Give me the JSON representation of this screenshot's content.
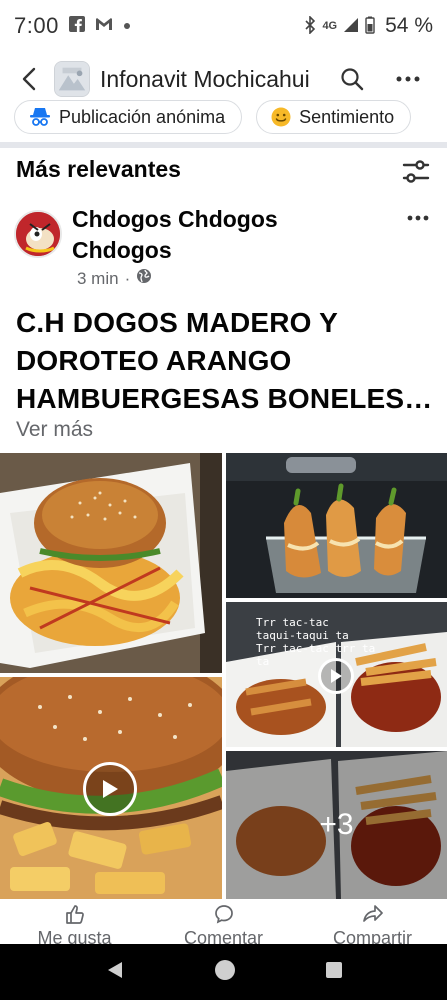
{
  "status_bar": {
    "time": "7:00",
    "left_icons": [
      "facebook-icon",
      "gmail-icon",
      "dot-icon"
    ],
    "network_label": "4G",
    "battery_percent": "54 %"
  },
  "header": {
    "title": "Infonavit Mochicahui",
    "back_icon": "back-arrow-icon",
    "search_icon": "search-icon",
    "more_icon": "more-horizontal-icon"
  },
  "chips": [
    {
      "label": "Publicación anónima",
      "icon": "anonymous-icon"
    },
    {
      "label": "Sentimiento",
      "icon": "smile-icon"
    }
  ],
  "section": {
    "title": "Más relevantes",
    "filter_icon": "sliders-icon"
  },
  "post": {
    "author": "Chdogos Chdogos Chdogos",
    "time": "3 min",
    "privacy_icon": "globe-icon",
    "text_lines": [
      "C.H DOGOS MADERO Y",
      "DOROTEO ARANGO",
      "HAMBUERGESAS BONELES…"
    ],
    "see_more": "Ver más",
    "video_caption": [
      "Trr tac-tac",
      "taqui-taqui ta",
      "Trr tac-tac trr ta",
      "ta"
    ],
    "extra_photos": "+3"
  },
  "actions": [
    {
      "label": "Me gusta",
      "icon": "thumbs-up-icon"
    },
    {
      "label": "Comentar",
      "icon": "comment-icon"
    },
    {
      "label": "Compartir",
      "icon": "share-icon"
    }
  ],
  "colors": {
    "meta_gray": "#65676b",
    "divider": "#e4e6eb",
    "accent_blue": "#1877f2"
  }
}
